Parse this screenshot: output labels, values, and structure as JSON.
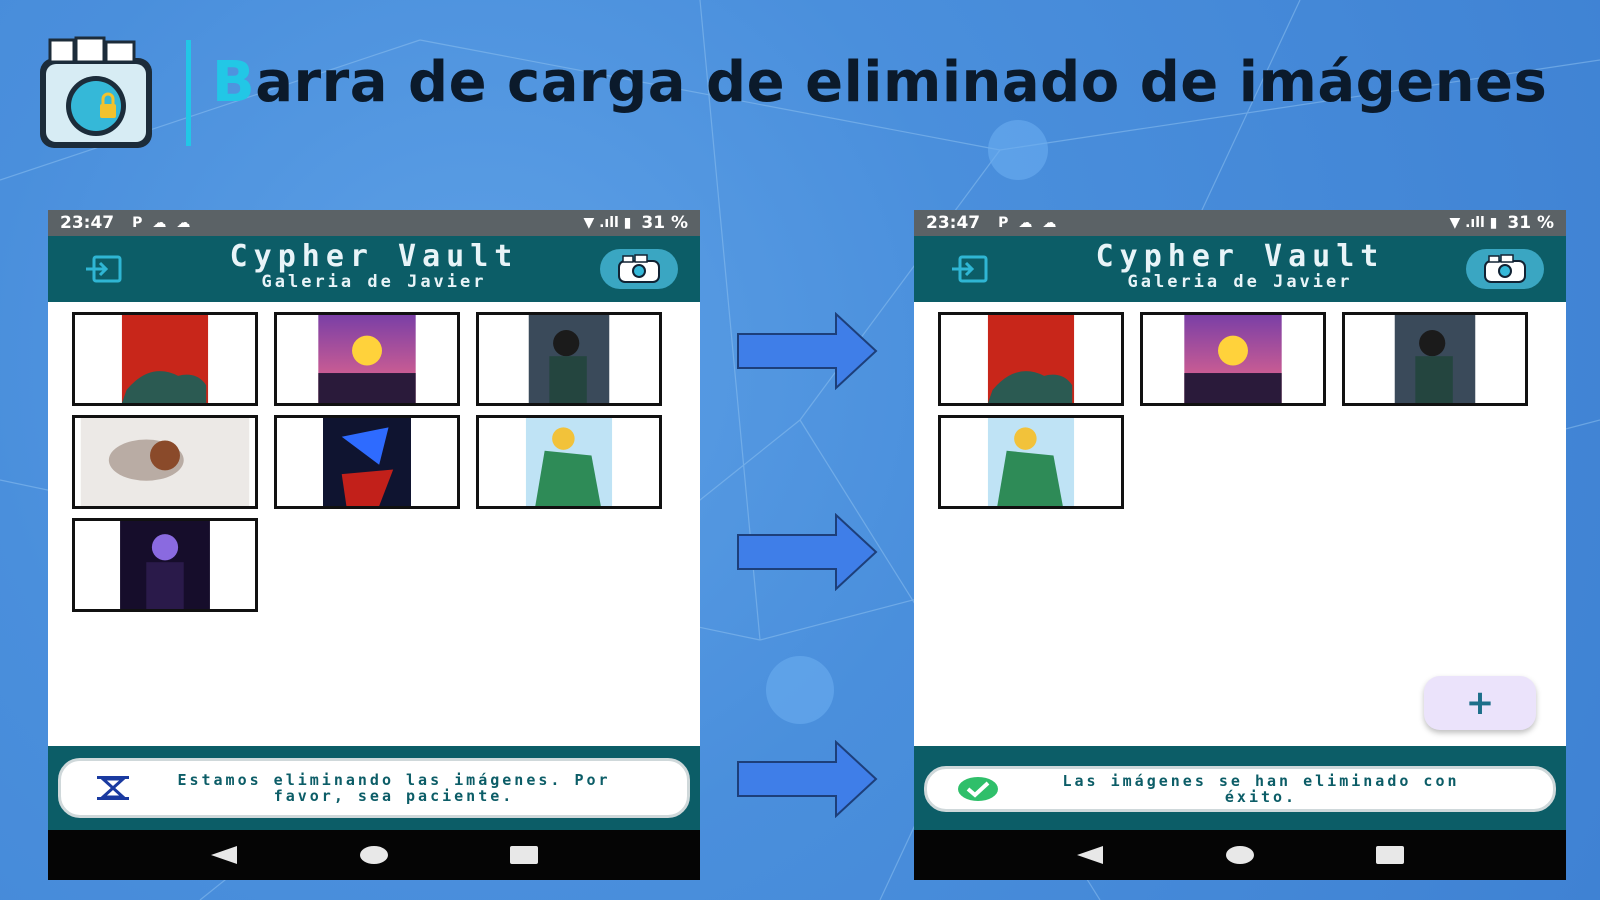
{
  "slide": {
    "title_first_letter": "B",
    "title_rest": "arra de carga de eliminado de imágenes"
  },
  "colors": {
    "accent": "#22c7e6",
    "appbar": "#0c5d67",
    "background": "#4a8fdc",
    "arrow": "#3f7ee8"
  },
  "phones": [
    {
      "status": {
        "time": "23:47",
        "battery": "31 %"
      },
      "appbar": {
        "title": "Cypher Vault",
        "subtitle": "Galeria de Javier"
      },
      "images": [
        "dragon-red",
        "sunset-car",
        "anime-boy-city",
        "girl-wolf",
        "dark-warrior",
        "anime-green-coat",
        "purple-sorcerer"
      ],
      "toast": {
        "icon": "hourglass-icon",
        "message": "Estamos eliminando las imágenes. Por favor, sea paciente."
      }
    },
    {
      "status": {
        "time": "23:47",
        "battery": "31 %"
      },
      "appbar": {
        "title": "Cypher Vault",
        "subtitle": "Galeria de Javier"
      },
      "images": [
        "dragon-red",
        "sunset-car",
        "anime-boy-city",
        "anime-green-coat"
      ],
      "fab": {
        "label": "+"
      },
      "toast": {
        "icon": "check-circle-icon",
        "message": "Las imágenes se han eliminado con éxito."
      }
    }
  ]
}
